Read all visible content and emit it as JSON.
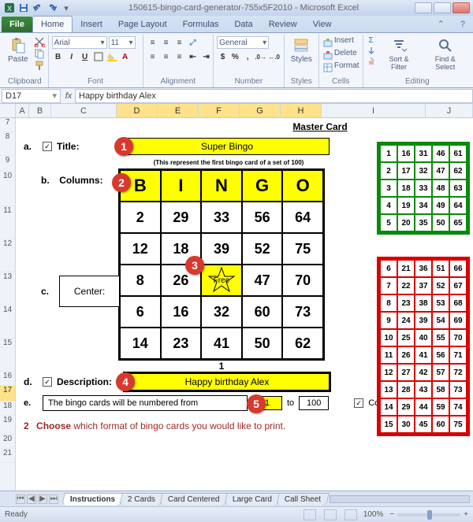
{
  "titlebar": {
    "title": "150615-bingo-card-generator-755x5F2010 - Microsoft Excel"
  },
  "tabs": {
    "file": "File",
    "home": "Home",
    "insert": "Insert",
    "page_layout": "Page Layout",
    "formulas": "Formulas",
    "data": "Data",
    "review": "Review",
    "view": "View"
  },
  "ribbon": {
    "clipboard": {
      "paste": "Paste",
      "label": "Clipboard"
    },
    "font": {
      "name": "Arial",
      "size": "11",
      "label": "Font"
    },
    "alignment": {
      "label": "Alignment"
    },
    "number": {
      "format": "General",
      "label": "Number"
    },
    "styles": {
      "btn": "Styles",
      "label": "Styles"
    },
    "cells": {
      "insert": "Insert",
      "delete": "Delete",
      "format": "Format",
      "label": "Cells"
    },
    "editing": {
      "sort": "Sort & Filter",
      "find": "Find & Select",
      "label": "Editing"
    }
  },
  "namebox": "D17",
  "fx": "fx",
  "formula": "Happy birthday Alex",
  "cols": [
    "",
    "A",
    "B",
    "C",
    "D",
    "E",
    "F",
    "G",
    "H",
    "I",
    "J"
  ],
  "rows": [
    "7",
    "8",
    "9",
    "10",
    "11",
    "12",
    "13",
    "14",
    "15",
    "16",
    "17",
    "18",
    "19",
    "20",
    "21"
  ],
  "master": "Master Card",
  "a": {
    "lab": "a.",
    "title_label": "Title:",
    "value": "Super Bingo",
    "note": "(This represent the first bingo card of a set of 100)"
  },
  "b": {
    "lab": "b.",
    "columns_label": "Columns:",
    "letters": [
      "B",
      "I",
      "N",
      "G",
      "O"
    ]
  },
  "c": {
    "lab": "c.",
    "center_label": "Center:"
  },
  "bingo_grid": [
    [
      "2",
      "29",
      "33",
      "56",
      "64"
    ],
    [
      "12",
      "18",
      "39",
      "52",
      "75"
    ],
    [
      "8",
      "26",
      "Free",
      "47",
      "70"
    ],
    [
      "6",
      "16",
      "32",
      "60",
      "73"
    ],
    [
      "14",
      "23",
      "41",
      "50",
      "62"
    ]
  ],
  "card_number": "1",
  "d": {
    "lab": "d.",
    "desc_label": "Description:",
    "value": "Happy birthday Alex"
  },
  "e": {
    "lab": "e.",
    "text1": "The bingo cards will be numbered from",
    "from": "1",
    "to_label": "to",
    "to": "100",
    "corners": "Corners"
  },
  "step2": {
    "num": "2",
    "bold": "Choose",
    "rest": " which format of bingo cards you would like to print."
  },
  "green_grid": [
    [
      "1",
      "16",
      "31",
      "46",
      "61"
    ],
    [
      "2",
      "17",
      "32",
      "47",
      "62"
    ],
    [
      "3",
      "18",
      "33",
      "48",
      "63"
    ],
    [
      "4",
      "19",
      "34",
      "49",
      "64"
    ],
    [
      "5",
      "20",
      "35",
      "50",
      "65"
    ]
  ],
  "red_grid": [
    [
      "6",
      "21",
      "36",
      "51",
      "66"
    ],
    [
      "7",
      "22",
      "37",
      "52",
      "67"
    ],
    [
      "8",
      "23",
      "38",
      "53",
      "68"
    ],
    [
      "9",
      "24",
      "39",
      "54",
      "69"
    ],
    [
      "10",
      "25",
      "40",
      "55",
      "70"
    ],
    [
      "11",
      "26",
      "41",
      "56",
      "71"
    ],
    [
      "12",
      "27",
      "42",
      "57",
      "72"
    ],
    [
      "13",
      "28",
      "43",
      "58",
      "73"
    ],
    [
      "14",
      "29",
      "44",
      "59",
      "74"
    ],
    [
      "15",
      "30",
      "45",
      "60",
      "75"
    ]
  ],
  "callouts": {
    "c1": "1",
    "c2": "2",
    "c3": "3",
    "c4": "4",
    "c5": "5"
  },
  "sheets": {
    "s1": "Instructions",
    "s2": "2 Cards",
    "s3": "Card Centered",
    "s4": "Large Card",
    "s5": "Call Sheet"
  },
  "status": {
    "ready": "Ready",
    "zoom": "100%"
  }
}
